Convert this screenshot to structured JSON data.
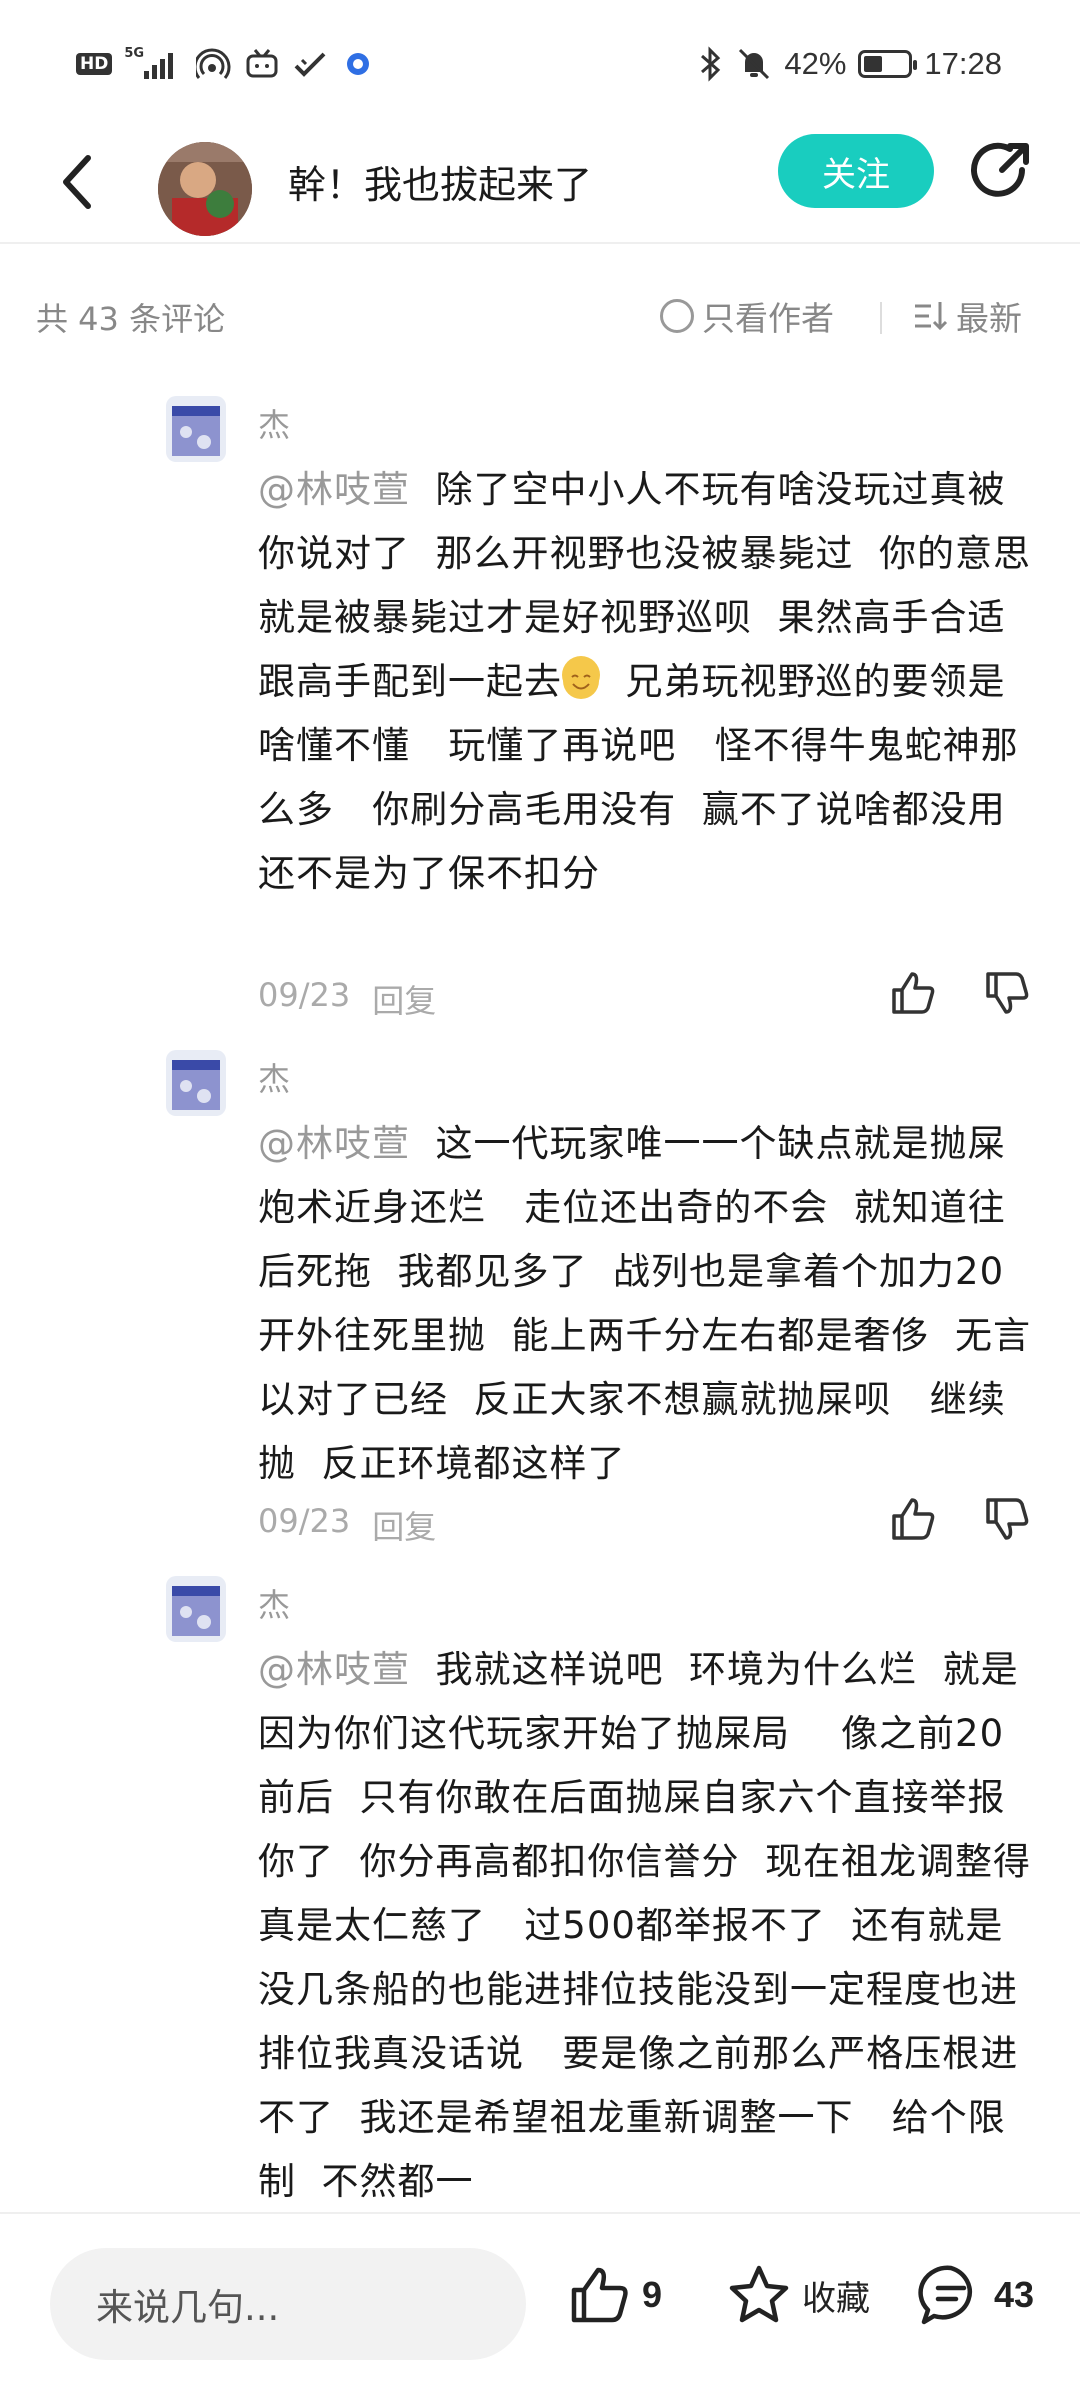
{
  "status_bar": {
    "hd": "HD",
    "network": "5G",
    "battery": "42%",
    "battery_level": 0.42,
    "time": "17:28"
  },
  "header": {
    "title": "幹！我也拔起来了",
    "follow_label": "关注"
  },
  "filter": {
    "count_label": "共 43 条评论",
    "author_only_label": "只看作者",
    "sort_label": "最新"
  },
  "comments": [
    {
      "name": "杰",
      "mention": "@林吱萱",
      "text_a": "  除了空中小人不玩有啥没玩过真被你说对了  那么开视野也没被暴毙过  你的意思就是被暴毙过才是好视野巡呗  果然高手合适跟高手配到一起去",
      "text_b": "  兄弟玩视野巡的要领是啥懂不懂   玩懂了再说吧   怪不得牛鬼蛇神那么多   你刷分高毛用没有  赢不了说啥都没用还不是为了保不扣分",
      "date": "09/23",
      "reply_label": "回复"
    },
    {
      "name": "杰",
      "mention": "@林吱萱",
      "text_a": "  这一代玩家唯一一个缺点就是抛屎  炮术近身还烂   走位还出奇的不会  就知道往后死拖  我都见多了  战列也是拿着个加力20开外往死里抛  能上两千分左右都是奢侈  无言以对了已经  反正大家不想赢就抛屎呗   继续抛  反正环境都这样了",
      "text_b": "",
      "date": "09/23",
      "reply_label": "回复"
    },
    {
      "name": "杰",
      "mention": "@林吱萱",
      "text_a": "  我就这样说吧  环境为什么烂  就是因为你们这代玩家开始了抛屎局    像之前20前后  只有你敢在后面抛屎自家六个直接举报你了  你分再高都扣你信誉分  现在祖龙调整得真是太仁慈了   过500都举报不了  还有就是没几条船的也能进排位技能没到一定程度也进排位我真没话说   要是像之前那么严格压根进不了  我还是希望祖龙重新调整一下   给个限制  不然都一",
      "text_b": "",
      "date": "",
      "reply_label": ""
    }
  ],
  "bottom_bar": {
    "input_placeholder": "来说几句...",
    "like_count": "9",
    "favorite_label": "收藏",
    "comment_count": "43"
  }
}
